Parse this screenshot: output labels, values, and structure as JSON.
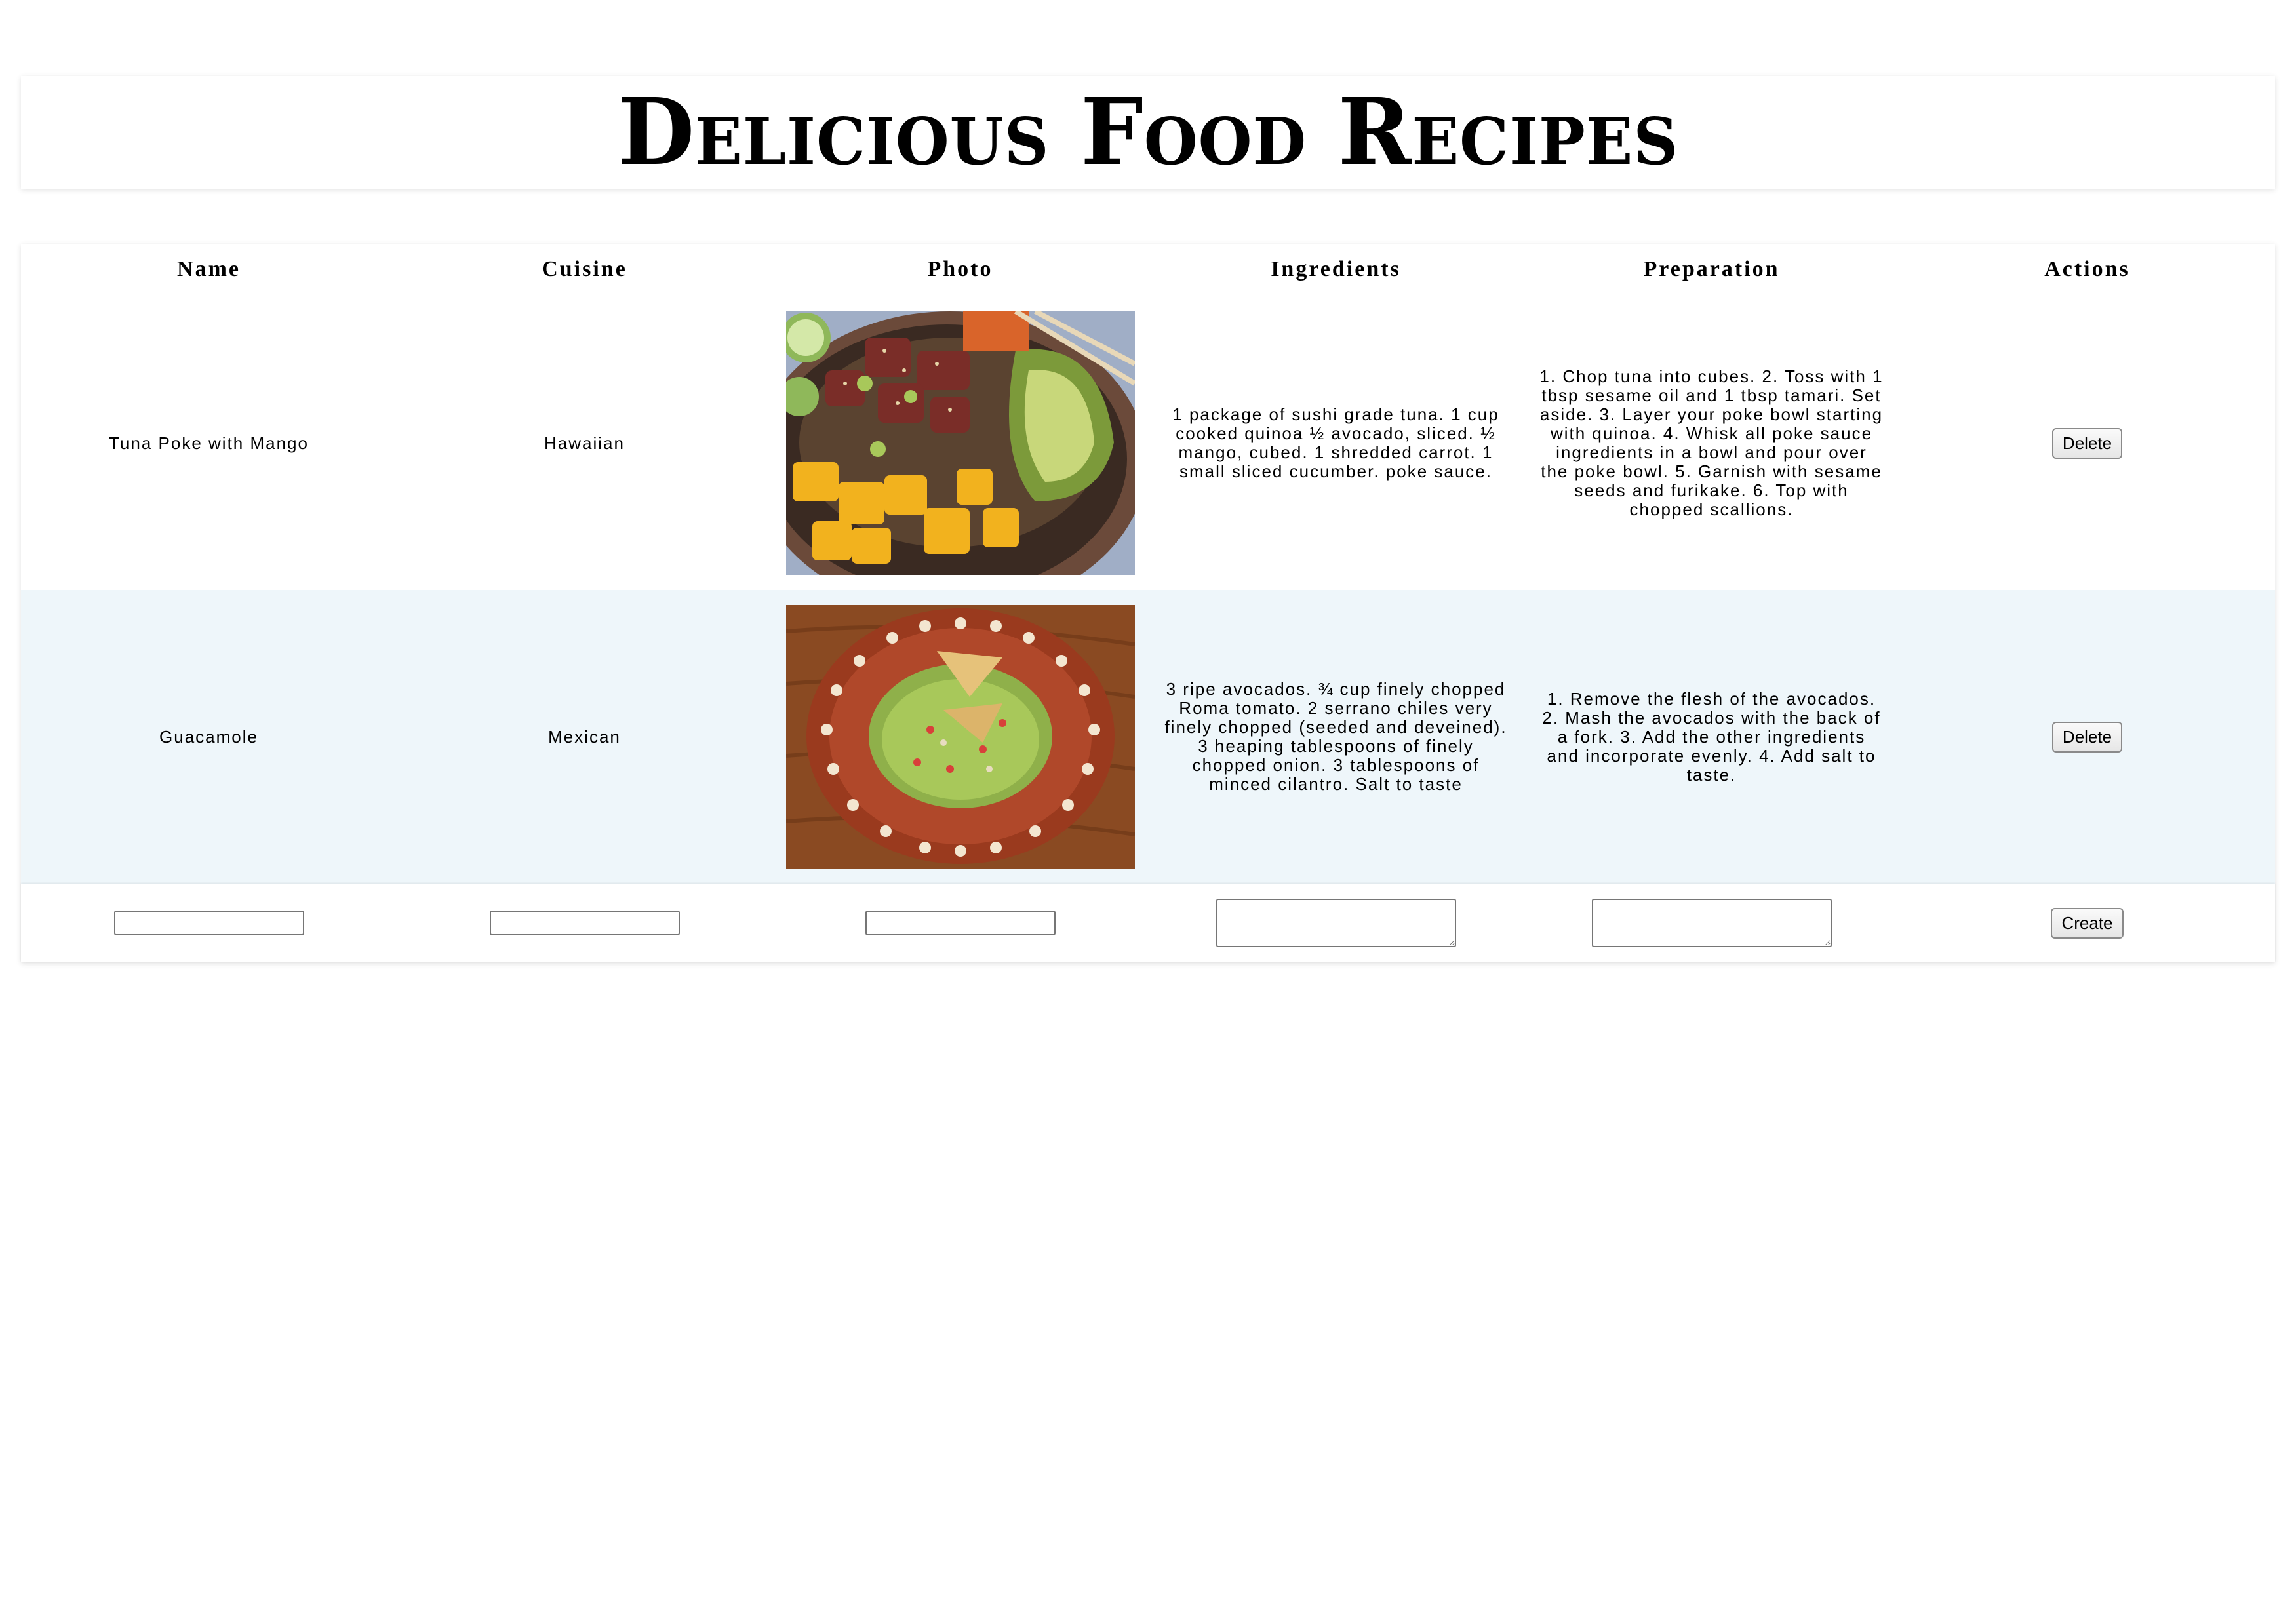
{
  "page": {
    "title": "Delicious Food Recipes"
  },
  "table": {
    "columns": [
      "Name",
      "Cuisine",
      "Photo",
      "Ingredients",
      "Preparation",
      "Actions"
    ],
    "rows": [
      {
        "name": "Tuna Poke with Mango",
        "cuisine": "Hawaiian",
        "photo_icon": "poke-bowl-photo",
        "ingredients": "1 package of sushi grade tuna. 1 cup cooked quinoa ½ avocado, sliced. ½ mango, cubed. 1 shredded carrot. 1 small sliced cucumber. poke sauce.",
        "preparation": "1. Chop tuna into cubes. 2. Toss with 1 tbsp sesame oil and 1 tbsp tamari. Set aside. 3. Layer your poke bowl starting with quinoa. 4. Whisk all poke sauce ingredients in a bowl and pour over the poke bowl. 5. Garnish with sesame seeds and furikake. 6. Top with chopped scallions.",
        "action_label": "Delete"
      },
      {
        "name": "Guacamole",
        "cuisine": "Mexican",
        "photo_icon": "guacamole-plate-photo",
        "ingredients": "3 ripe avocados. ¾ cup finely chopped Roma tomato. 2 serrano chiles very finely chopped (seeded and deveined). 3 heaping tablespoons of finely chopped onion. 3 tablespoons of minced cilantro. Salt to taste",
        "preparation": "1. Remove the flesh of the avocados. 2. Mash the avocados with the back of a fork. 3. Add the other ingredients and incorporate evenly. 4. Add salt to taste.",
        "action_label": "Delete"
      }
    ],
    "create_row": {
      "name_value": "",
      "cuisine_value": "",
      "photo_value": "",
      "ingredients_value": "",
      "preparation_value": "",
      "action_label": "Create"
    }
  },
  "colors": {
    "alt_row_bg": "#eef6fa",
    "card_bg": "#ffffff"
  }
}
